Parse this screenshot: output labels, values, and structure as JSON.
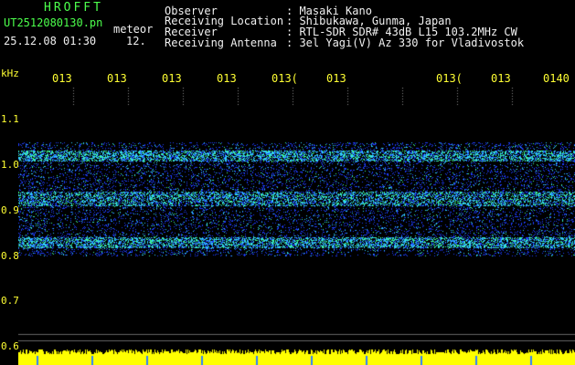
{
  "header": {
    "app_title": "HROFFT",
    "file_name": "UT2512080130.pn",
    "file_tag": "meteor",
    "datetime": "25.12.08 01:30",
    "time_extra": "12."
  },
  "info": [
    {
      "label": "Observer",
      "value": ": Masaki Kano"
    },
    {
      "label": "Receiving Location",
      "value": ": Shibukawa, Gunma, Japan"
    },
    {
      "label": "Receiver",
      "value": ": RTL-SDR SDR# 43dB L15 103.2MHz CW"
    },
    {
      "label": "Receiving Antenna",
      "value": ": 3el Yagi(V) Az 330 for Vladivostok"
    }
  ],
  "axis": {
    "y_unit": "kHz",
    "y_ticks": [
      "1.1",
      "1.0",
      "0.9",
      "0.8",
      "0.7",
      "0.6"
    ],
    "x_ticks": [
      "013",
      "013",
      "013",
      "013",
      "013(",
      "013",
      "013(",
      "013",
      "0140"
    ]
  },
  "colors": {
    "background": "#000000",
    "text_green": "#4cff4c",
    "text_white": "#f0f0f0",
    "text_yellow": "#ffff33",
    "signal_blue": "#1e3cff",
    "signal_cyan": "#30d0ff",
    "signal_green": "#40ff90",
    "baseline_yellow": "#ffff00"
  }
}
